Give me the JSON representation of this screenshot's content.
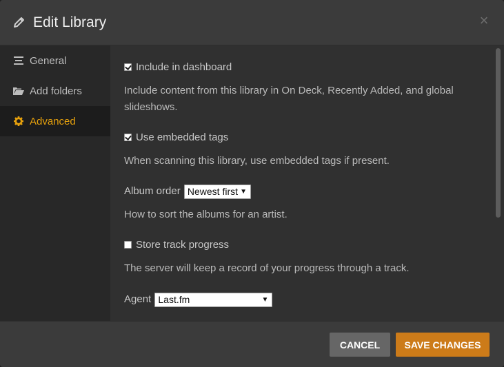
{
  "header": {
    "title": "Edit Library",
    "close_glyph": "×"
  },
  "sidebar": {
    "items": [
      {
        "label": "General",
        "icon": "list-icon",
        "active": false
      },
      {
        "label": "Add folders",
        "icon": "folder-icon",
        "active": false
      },
      {
        "label": "Advanced",
        "icon": "gear-icon",
        "active": true
      }
    ]
  },
  "content": {
    "include_dashboard": {
      "label": "Include in dashboard",
      "checked": true,
      "help": "Include content from this library in On Deck, Recently Added, and global slideshows."
    },
    "embedded_tags": {
      "label": "Use embedded tags",
      "checked": true,
      "help": "When scanning this library, use embedded tags if present."
    },
    "album_order": {
      "label": "Album order",
      "value": "Newest first",
      "help": "How to sort the albums for an artist."
    },
    "track_progress": {
      "label": "Store track progress",
      "checked": false,
      "help": "The server will keep a record of your progress through a track."
    },
    "agent": {
      "label": "Agent",
      "value": "Last.fm"
    }
  },
  "footer": {
    "cancel_label": "CANCEL",
    "save_label": "SAVE CHANGES"
  },
  "colors": {
    "accent": "#e5a00d",
    "save_button": "#cc7b19",
    "cancel_button": "#666666"
  }
}
